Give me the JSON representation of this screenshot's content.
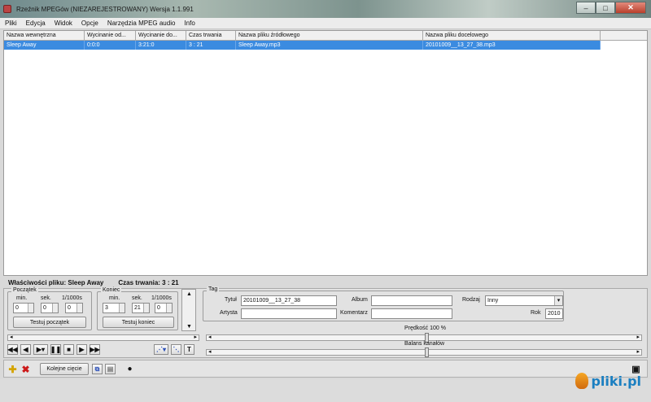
{
  "window": {
    "title": "Rzeźnik MPEGów  (NIEZAREJESTROWANY)  Wersja 1.1.991"
  },
  "menu": [
    "Pliki",
    "Edycja",
    "Widok",
    "Opcje",
    "Narzędzia MPEG audio",
    "Info"
  ],
  "table": {
    "columns": [
      "Nazwa wewnętrzna",
      "Wycinanie od...",
      "Wycinanie do...",
      "Czas trwania",
      "Nazwa pliku źródłowego",
      "Nazwa pliku docelowego"
    ],
    "rows": [
      [
        "Sleep Away",
        "0:0:0",
        "3:21:0",
        "3 : 21",
        "Sleep Away.mp3",
        "20101009__13_27_38.mp3"
      ]
    ]
  },
  "props": {
    "label": "Właściwości pliku: Sleep Away",
    "duration": "Czas trwania: 3 : 21"
  },
  "start": {
    "title": "Początek",
    "min_label": "min.",
    "sec_label": "sek.",
    "ms_label": "1/1000s",
    "min": "0",
    "sec": "0",
    "ms": "0",
    "test_button": "Testuj początek"
  },
  "end": {
    "title": "Koniec",
    "min_label": "min.",
    "sec_label": "sek.",
    "ms_label": "1/1000s",
    "min": "3",
    "sec": "21",
    "ms": "0",
    "test_button": "Testuj koniec"
  },
  "tag": {
    "title": "Tag",
    "title_label": "Tytuł",
    "title_value": "20101009__13_27_38",
    "artist_label": "Artysta",
    "artist_value": "",
    "album_label": "Album",
    "album_value": "",
    "comment_label": "Komentarz",
    "comment_value": "",
    "genre_label": "Rodzaj",
    "genre_value": "Inny",
    "year_label": "Rok",
    "year_value": "2010"
  },
  "speed": {
    "label": "Prędkość 100 %"
  },
  "balance": {
    "label": "Balans kanałów"
  },
  "bottom": {
    "next_cut_button": "Kolejne cięcie"
  },
  "watermark": {
    "text": "pliki.pl"
  },
  "icons": {
    "toolbar": [
      "rewind-icon",
      "prev-icon",
      "play-icon",
      "pause-icon",
      "stop-icon",
      "next-icon",
      "fast-forward-icon"
    ],
    "bottom": [
      "add-icon",
      "delete-icon",
      "copy-icon",
      "paste-icon",
      "record-icon",
      "save-icon"
    ]
  }
}
